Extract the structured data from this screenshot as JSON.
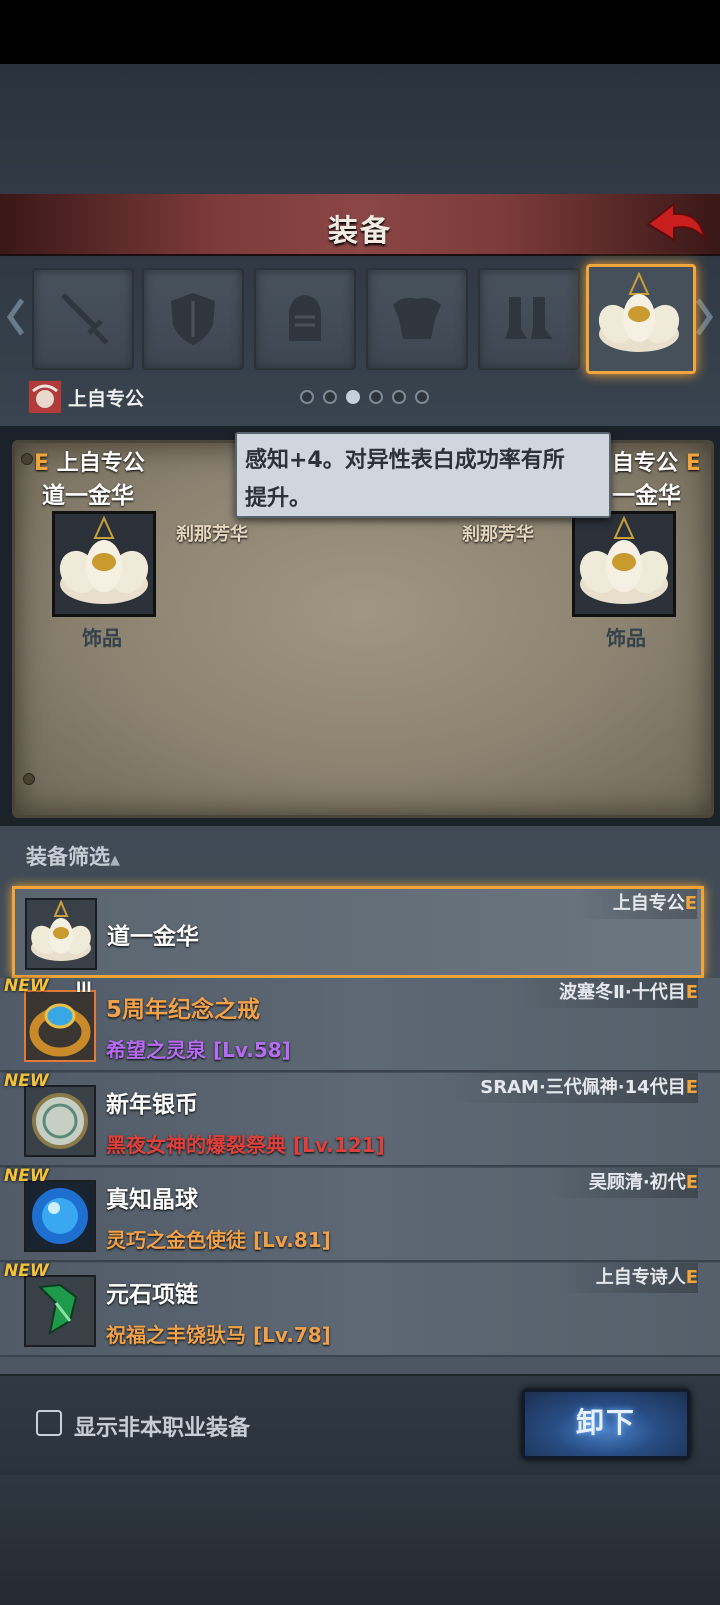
{
  "header": {
    "title": "装备"
  },
  "slots": [
    {
      "name": "weapon",
      "icon": "sword-icon"
    },
    {
      "name": "shield",
      "icon": "shield-icon"
    },
    {
      "name": "helmet",
      "icon": "helmet-icon"
    },
    {
      "name": "armor",
      "icon": "armor-icon"
    },
    {
      "name": "boots",
      "icon": "boots-icon"
    },
    {
      "name": "accessory",
      "icon": "lotus-icon",
      "active": true
    }
  ],
  "owner": {
    "name": "上自专公"
  },
  "pager": {
    "count": 6,
    "active": 3
  },
  "compare": {
    "left": {
      "grade": "E",
      "owner": "上自专公",
      "item_name": "道一金华",
      "set": "刹那芳华",
      "type": "饰品"
    },
    "right": {
      "grade": "E",
      "owner": "自专公",
      "item_name": "一金华",
      "set": "刹那芳华",
      "type": "饰品"
    }
  },
  "tooltip": {
    "line1": "感知+4。对异性表白成功率有所",
    "line2": "提升。"
  },
  "filter": {
    "label": "装备筛选"
  },
  "list": {
    "selected": {
      "name": "道一金华",
      "owner": "上自专公",
      "grade": "E"
    },
    "items": [
      {
        "badge": "NEW",
        "tier": "III",
        "name": "5周年纪念之戒",
        "set": "希望之灵泉 [Lv.58]",
        "owner": "波塞冬Ⅱ·十代目",
        "grade": "E",
        "set_color": "#b56cf0",
        "name_color": "orange"
      },
      {
        "badge": "NEW",
        "name": "新年银币",
        "set": "黑夜女神的爆裂祭典 [Lv.121]",
        "owner": "SRAM·三代佩神·14代目",
        "grade": "E",
        "set_color": "#e0403c"
      },
      {
        "badge": "NEW",
        "name": "真知晶球",
        "set": "灵巧之金色使徒 [Lv.81]",
        "owner": "吴顾清·初代",
        "grade": "E",
        "set_color": "#f0a14a"
      },
      {
        "badge": "NEW",
        "name": "元石项链",
        "set": "祝福之丰饶驮马 [Lv.78]",
        "owner": "上自专诗人",
        "grade": "E",
        "set_color": "#f0a14a"
      }
    ]
  },
  "footer": {
    "checkbox_label": "显示非本职业装备",
    "unequip_label": "卸下"
  }
}
